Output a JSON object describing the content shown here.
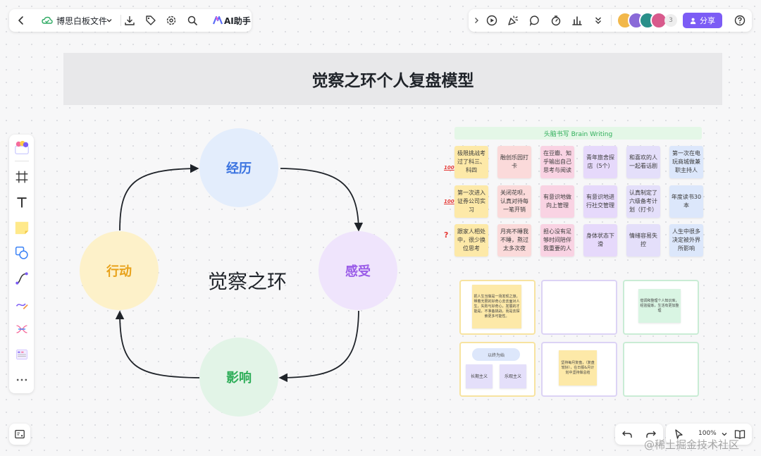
{
  "top_left_toolbar": {
    "file_name": "博思白板文件",
    "ai_label": "AI助手"
  },
  "top_right_toolbar": {
    "avatar_count": "3",
    "share_label": "分享"
  },
  "board": {
    "title": "觉察之环个人复盘模型",
    "cycle": {
      "center_label": "觉察之环",
      "nodes": {
        "experience": "经历",
        "feeling": "感受",
        "impact": "影响",
        "action": "行动"
      }
    },
    "brainwriting": {
      "header": "头脑书写 Brain Writing",
      "row_marks": [
        "100",
        "100",
        "?"
      ],
      "rows": [
        [
          "极限挑战考过了科三、科四",
          "融创乐园打卡",
          "在豆瓣、知乎输出自己思考与阅读",
          "青年旅舍探店（5个）",
          "和喜欢的人一起看话剧",
          "第一次在电玩商城做兼职主持人"
        ],
        [
          "第一次进入证券公司实习",
          "关闭花呗，认真对待每一笔开销",
          "有意识地做向上管理",
          "有意识地进行社交管理",
          "认真制定了六级备考计划（打卡）",
          "年度读书30本"
        ],
        [
          "跟家人相处中，很少换位思考",
          "月亮不睡我不睡，熬过太多次夜",
          "担心没有足够时间陪伴我重要的人",
          "身体状态下滑",
          "情绪容易失控",
          "人生中很多决定被外界所影响"
        ]
      ]
    },
    "frames": {
      "f1_note": "把人生当做是一场发现之旅，带着无限的好奇心去去面对人生，失败与好奇心，发展的才能是，不准备挑战，而是去探索更多可能性。",
      "f3_note": "借调和整理个人知识库，经验提炼，生活有更加整理",
      "f4_pill": "以终为始",
      "f4_left": "长期主义",
      "f4_right": "乐观主义",
      "f5_note": "坚持每月复盘，（复盘较好），在日报&月计划中坚持做总结"
    }
  },
  "bottom_right": {
    "zoom": "100%"
  },
  "watermark": "@稀土掘金技术社区",
  "colors": {
    "accent_purple": "#7c5cf5",
    "experience_bg": "#e3edfc",
    "feeling_bg": "#efe4fc",
    "impact_bg": "#e2f4e7",
    "action_bg": "#fdf1c9",
    "header_bg": "#e8e8ea"
  }
}
